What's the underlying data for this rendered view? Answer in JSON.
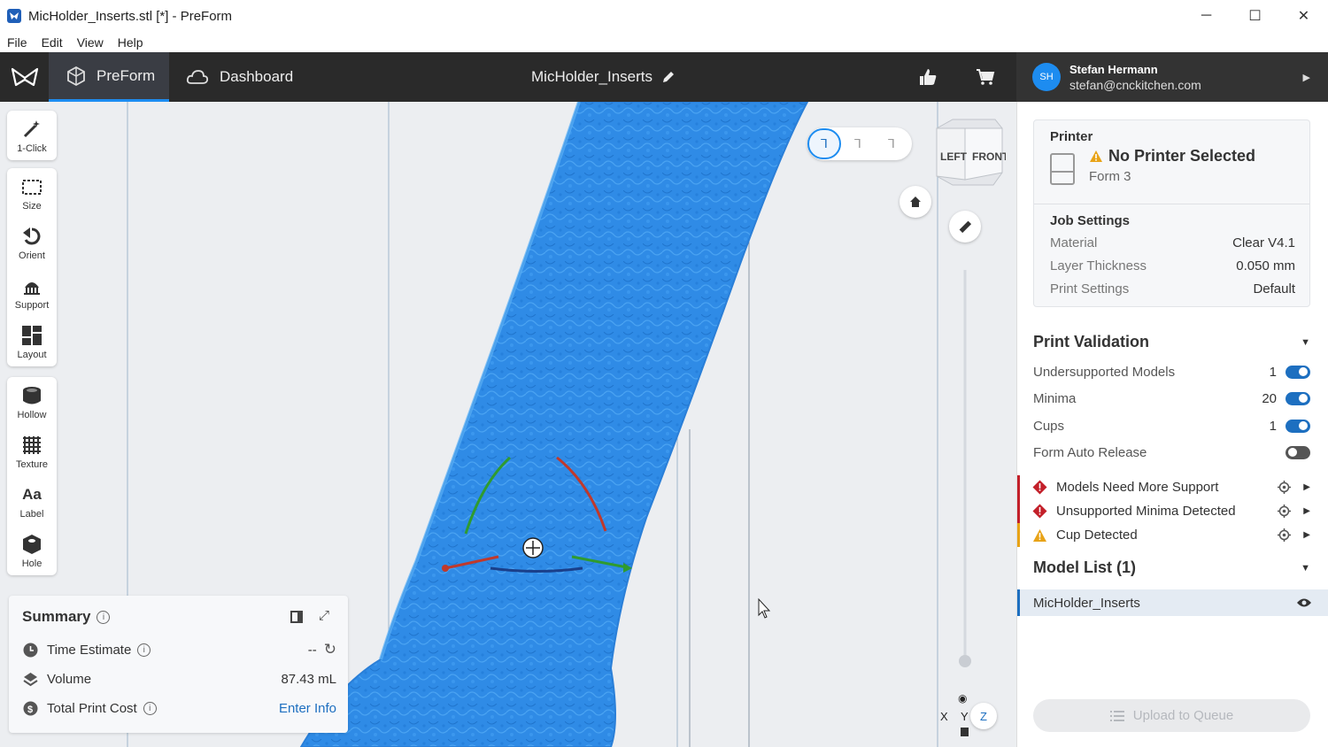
{
  "window": {
    "title": "MicHolder_Inserts.stl [*] - PreForm",
    "controls": {
      "minimize": "─",
      "maximize": "☐",
      "close": "✕"
    }
  },
  "menu": [
    "File",
    "Edit",
    "View",
    "Help"
  ],
  "header": {
    "tabs": [
      {
        "label": "PreForm",
        "active": true
      },
      {
        "label": "Dashboard",
        "active": false
      }
    ],
    "job_name": "MicHolder_Inserts",
    "account": {
      "initials": "SH",
      "name": "Stefan Hermann",
      "email": "stefan@cnckitchen.com"
    }
  },
  "toolbar": {
    "groups": [
      [
        {
          "label": "1-Click",
          "icon": "wand-icon"
        }
      ],
      [
        {
          "label": "Size",
          "icon": "size-icon"
        },
        {
          "label": "Orient",
          "icon": "orient-icon"
        },
        {
          "label": "Support",
          "icon": "support-icon"
        },
        {
          "label": "Layout",
          "icon": "layout-icon"
        }
      ],
      [
        {
          "label": "Hollow",
          "icon": "hollow-icon"
        },
        {
          "label": "Texture",
          "icon": "texture-icon"
        },
        {
          "label": "Label",
          "icon": "label-icon"
        },
        {
          "label": "Hole",
          "icon": "hole-icon"
        }
      ]
    ]
  },
  "summary": {
    "title": "Summary",
    "rows": [
      {
        "label": "Time Estimate",
        "value": "--",
        "icon": "clock-icon",
        "info": true
      },
      {
        "label": "Volume",
        "value": "87.43 mL",
        "icon": "volume-icon",
        "info": false
      },
      {
        "label": "Total Print Cost",
        "value": "Enter Info",
        "icon": "dollar-icon",
        "info": true
      }
    ]
  },
  "view_cube": {
    "left": "LEFT",
    "front": "FRONT"
  },
  "axes": {
    "x": "X",
    "y": "Y",
    "z": "Z"
  },
  "printer": {
    "section": "Printer",
    "status": "No Printer Selected",
    "model": "Form 3"
  },
  "job_settings": {
    "section": "Job Settings",
    "rows": [
      {
        "label": "Material",
        "value": "Clear V4.1"
      },
      {
        "label": "Layer Thickness",
        "value": "0.050 mm"
      },
      {
        "label": "Print Settings",
        "value": "Default"
      }
    ]
  },
  "print_validation": {
    "section": "Print Validation",
    "rows": [
      {
        "label": "Undersupported Models",
        "count": "1",
        "on": true
      },
      {
        "label": "Minima",
        "count": "20",
        "on": true
      },
      {
        "label": "Cups",
        "count": "1",
        "on": true
      },
      {
        "label": "Form Auto Release",
        "count": "",
        "on": false
      }
    ],
    "issues": [
      {
        "label": "Models Need More Support",
        "severity": "error"
      },
      {
        "label": "Unsupported Minima Detected",
        "severity": "error"
      },
      {
        "label": "Cup Detected",
        "severity": "warning"
      }
    ]
  },
  "model_list": {
    "section": "Model List (1)",
    "items": [
      {
        "name": "MicHolder_Inserts"
      }
    ]
  },
  "upload_button": "Upload to Queue",
  "colors": {
    "accent": "#1d8cf0",
    "model_blue": "#2f8be6",
    "error": "#c3202a",
    "warning": "#e8a317",
    "header_bg": "#2a2a2a"
  }
}
